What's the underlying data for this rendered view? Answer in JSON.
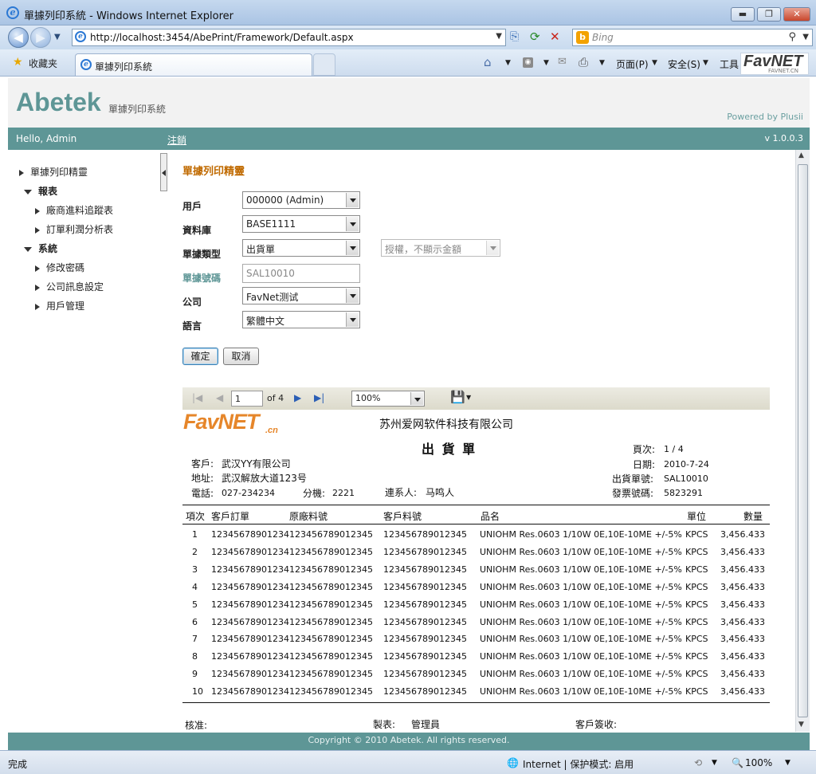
{
  "window": {
    "title": "單據列印系統 - Windows Internet Explorer",
    "min": "▬",
    "max": "❐",
    "close": "✕"
  },
  "address": {
    "url": "http://localhost:3454/AbePrint/Framework/Default.aspx",
    "search_placeholder": "Bing"
  },
  "favbar": {
    "favorites": "收藏夹",
    "tab_title": "單據列印系統",
    "menu_page": "页面(P)",
    "menu_safety": "安全(S)",
    "menu_tools": "工具",
    "brand": "FavNET",
    "brand_sub": "FAVNET.CN"
  },
  "header": {
    "logo": "Abetek",
    "subtitle": "單據列印系統",
    "powered": "Powered by Plusii"
  },
  "navstrip": {
    "hello": "Hello, Admin",
    "logout": "注銷",
    "version": "v 1.0.0.3"
  },
  "sidebar": {
    "items": [
      {
        "label": "單據列印精靈",
        "expanded": false
      },
      {
        "label": "報表",
        "expanded": true
      },
      {
        "label": "廠商進料追蹤表",
        "expanded": false
      },
      {
        "label": "訂單利潤分析表",
        "expanded": false
      },
      {
        "label": "系統",
        "expanded": true
      },
      {
        "label": "修改密碼",
        "expanded": false
      },
      {
        "label": "公司訊息設定",
        "expanded": false
      },
      {
        "label": "用戶管理",
        "expanded": false
      }
    ]
  },
  "form": {
    "heading": "單據列印精靈",
    "user_label": "用戶",
    "user_value": "000000 (Admin)",
    "db_label": "資料庫",
    "db_value": "BASE1111",
    "type_label": "單據類型",
    "type_value": "出貨單",
    "auth_value": "授權，不顯示金額",
    "no_label": "單據號碼",
    "no_value": "SAL10010",
    "company_label": "公司",
    "company_value": "FavNet测试",
    "lang_label": "語言",
    "lang_value": "繁體中文",
    "ok": "確定",
    "cancel": "取消"
  },
  "report_toolbar": {
    "page": "1",
    "of": "of 4",
    "zoom": "100%"
  },
  "report": {
    "brand": "FavNET",
    "brand_suffix": ".cn",
    "company": "苏州爱网软件科技有限公司",
    "doc_title": "出 貨 單",
    "page_label": "頁次:",
    "page_value": "1 / 4",
    "date_label": "日期:",
    "date_value": "2010-7-24",
    "ship_label": "出貨單號:",
    "ship_value": "SAL10010",
    "invoice_label": "發票號碼:",
    "invoice_value": "5823291",
    "customer_label": "客戶:",
    "customer_value": "武汉YY有限公司",
    "address_label": "地址:",
    "address_value": "武汉解放大道123号",
    "phone_label": "電話:",
    "phone_value": "027-234234",
    "ext_label": "分機:",
    "ext_value": "2221",
    "contact_label": "連系人:",
    "contact_value": "马鸣人",
    "columns": [
      "項次",
      "客戶訂單",
      "原廠料號",
      "客戶料號",
      "品名",
      "單位",
      "數量"
    ],
    "rows": [
      [
        "1",
        "12345678901234",
        "123456789012345",
        "123456789012345",
        "UNIOHM Res.0603 1/10W 0E,10E-10ME +/-5%",
        "KPCS",
        "3,456.433"
      ],
      [
        "2",
        "12345678901234",
        "123456789012345",
        "123456789012345",
        "UNIOHM Res.0603 1/10W 0E,10E-10ME +/-5%",
        "KPCS",
        "3,456.433"
      ],
      [
        "3",
        "12345678901234",
        "123456789012345",
        "123456789012345",
        "UNIOHM Res.0603 1/10W 0E,10E-10ME +/-5%",
        "KPCS",
        "3,456.433"
      ],
      [
        "4",
        "12345678901234",
        "123456789012345",
        "123456789012345",
        "UNIOHM Res.0603 1/10W 0E,10E-10ME +/-5%",
        "KPCS",
        "3,456.433"
      ],
      [
        "5",
        "12345678901234",
        "123456789012345",
        "123456789012345",
        "UNIOHM Res.0603 1/10W 0E,10E-10ME +/-5%",
        "KPCS",
        "3,456.433"
      ],
      [
        "6",
        "12345678901234",
        "123456789012345",
        "123456789012345",
        "UNIOHM Res.0603 1/10W 0E,10E-10ME +/-5%",
        "KPCS",
        "3,456.433"
      ],
      [
        "7",
        "12345678901234",
        "123456789012345",
        "123456789012345",
        "UNIOHM Res.0603 1/10W 0E,10E-10ME +/-5%",
        "KPCS",
        "3,456.433"
      ],
      [
        "8",
        "12345678901234",
        "123456789012345",
        "123456789012345",
        "UNIOHM Res.0603 1/10W 0E,10E-10ME +/-5%",
        "KPCS",
        "3,456.433"
      ],
      [
        "9",
        "12345678901234",
        "123456789012345",
        "123456789012345",
        "UNIOHM Res.0603 1/10W 0E,10E-10ME +/-5%",
        "KPCS",
        "3,456.433"
      ],
      [
        "10",
        "12345678901234",
        "123456789012345",
        "123456789012345",
        "UNIOHM Res.0603 1/10W 0E,10E-10ME +/-5%",
        "KPCS",
        "3,456.433"
      ]
    ],
    "footer_approve": "核准:",
    "footer_maker_label": "製表:",
    "footer_maker_value": "管理員",
    "footer_sign": "客戶簽收:"
  },
  "footer": {
    "copyright": "Copyright © 2010 Abetek. All rights reserved."
  },
  "status": {
    "done": "完成",
    "zone": "Internet | 保护模式: 启用",
    "zoom": "100%"
  },
  "colors": {
    "accent": "#5e9696",
    "heading": "#c06a00"
  }
}
